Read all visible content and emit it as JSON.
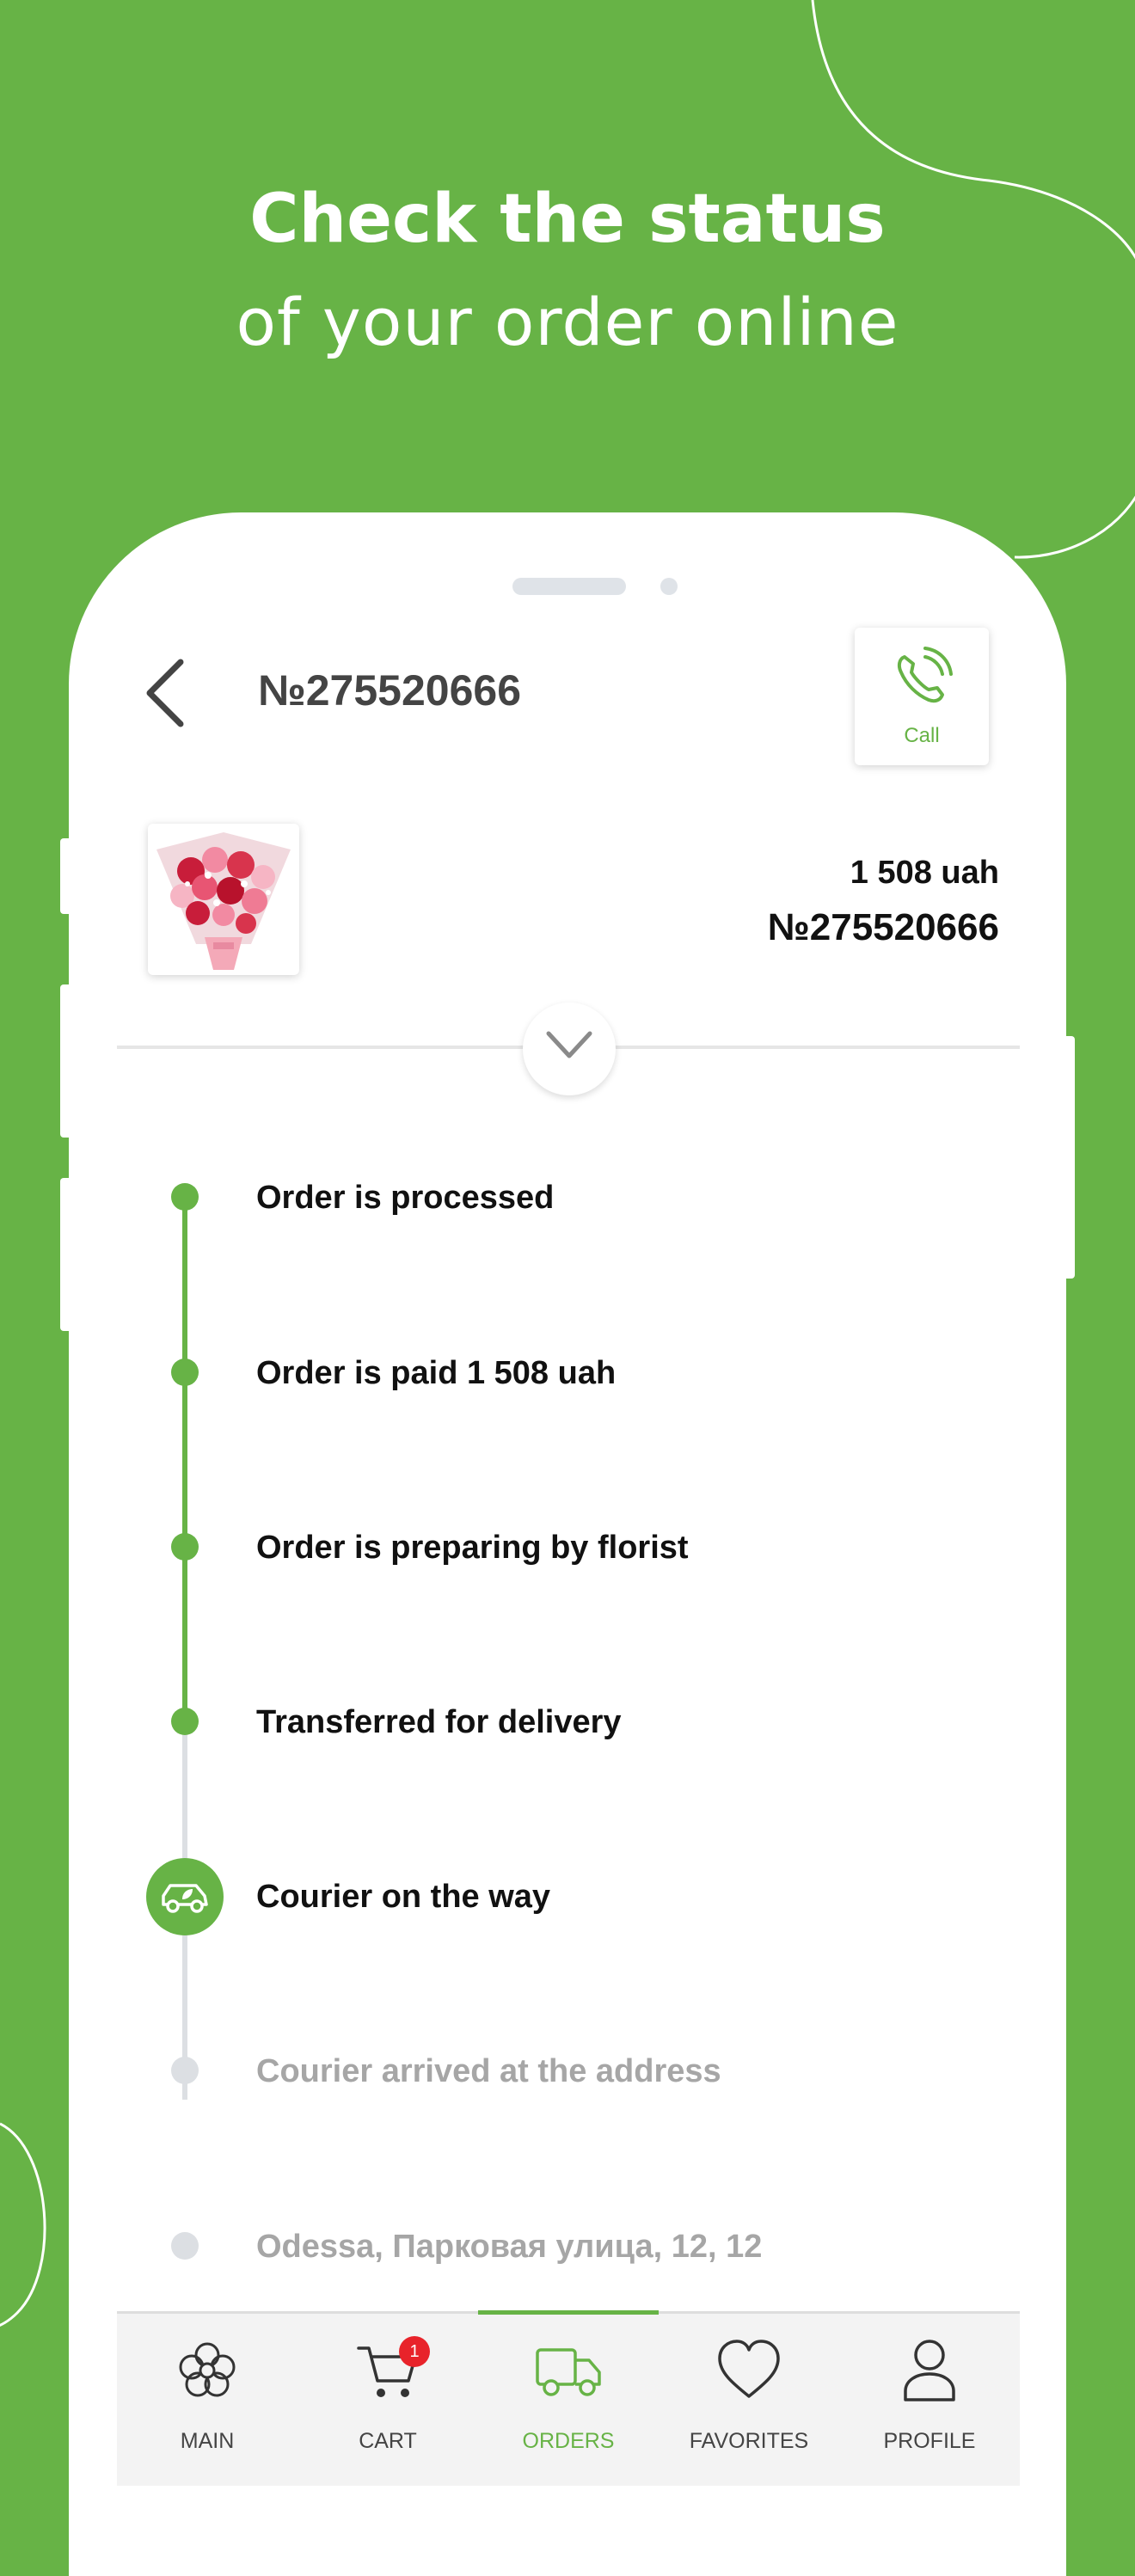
{
  "promo": {
    "headline_bold": "Check the status",
    "headline_regular": "of your order online"
  },
  "colors": {
    "brand_green": "#67b346",
    "inactive_gray": "#dcdfe3",
    "badge_red": "#e8232a"
  },
  "header": {
    "back_icon": "chevron-left-icon",
    "title": "№275520666",
    "call_label": "Call",
    "call_icon": "phone-ringing-icon"
  },
  "order": {
    "image": "flower-bouquet-thumbnail",
    "price": "1 508 uah",
    "number": "№275520666"
  },
  "timeline": [
    {
      "label": "Order is processed",
      "state": "done"
    },
    {
      "label": "Order is paid 1 508 uah",
      "state": "done"
    },
    {
      "label": "Order is preparing by florist",
      "state": "done"
    },
    {
      "label": "Transferred for delivery",
      "state": "done"
    },
    {
      "label": "Courier on the way",
      "state": "current",
      "icon": "eco-car-icon"
    },
    {
      "label": "Courier arrived at the address",
      "state": "pending"
    },
    {
      "label": "Odessa, Парковая улица, 12, 12",
      "state": "pending"
    }
  ],
  "tabbar": {
    "items": [
      {
        "label": "MAIN",
        "icon": "flower-icon"
      },
      {
        "label": "CART",
        "icon": "cart-icon",
        "badge": "1"
      },
      {
        "label": "ORDERS",
        "icon": "truck-icon",
        "active": true
      },
      {
        "label": "FAVORITES",
        "icon": "heart-icon"
      },
      {
        "label": "PROFILE",
        "icon": "user-icon"
      }
    ]
  }
}
